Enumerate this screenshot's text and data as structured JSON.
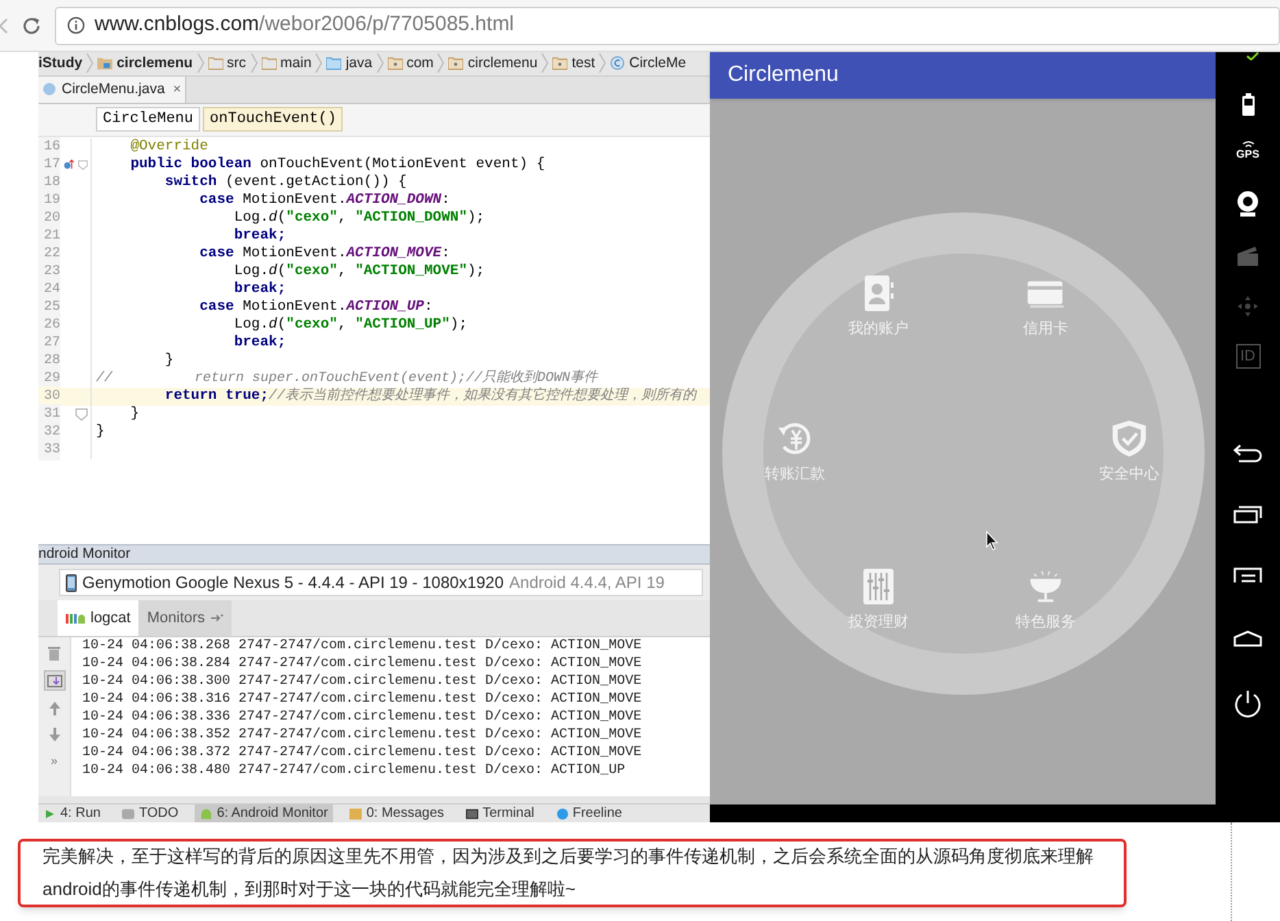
{
  "browser": {
    "url_host": "www.cnblogs.com",
    "url_path": "/webor2006/p/7705085.html"
  },
  "ide": {
    "breadcrumbs": [
      {
        "label": "iStudy",
        "kind": "project"
      },
      {
        "label": "circlemenu",
        "kind": "module"
      },
      {
        "label": "src",
        "kind": "folder"
      },
      {
        "label": "main",
        "kind": "folder"
      },
      {
        "label": "java",
        "kind": "source"
      },
      {
        "label": "com",
        "kind": "package"
      },
      {
        "label": "circlemenu",
        "kind": "package"
      },
      {
        "label": "test",
        "kind": "package"
      },
      {
        "label": "CircleMe",
        "kind": "class"
      }
    ],
    "file_tab": {
      "label": "CircleMenu.java",
      "close": "×"
    },
    "method_breadcrumbs": [
      {
        "label": "CircleMenu",
        "selected": false
      },
      {
        "label": "onTouchEvent()",
        "selected": true
      }
    ],
    "code_lines": [
      {
        "number": "16",
        "current": false,
        "override_marker": false,
        "fold_marker": false,
        "segments": [
          {
            "text": "    @Override",
            "kind": "annotation"
          }
        ]
      },
      {
        "number": "17",
        "current": false,
        "override_marker": true,
        "fold_marker": true,
        "segments": [
          {
            "text": "    public boolean",
            "kind": "keyword"
          },
          {
            "text": " onTouchEvent(MotionEvent event) {",
            "kind": "plain"
          }
        ]
      },
      {
        "number": "18",
        "current": false,
        "override_marker": false,
        "fold_marker": false,
        "segments": [
          {
            "text": "        switch",
            "kind": "keyword"
          },
          {
            "text": " (event.getAction()) {",
            "kind": "plain"
          }
        ]
      },
      {
        "number": "19",
        "current": false,
        "override_marker": false,
        "fold_marker": false,
        "segments": [
          {
            "text": "            case",
            "kind": "keyword"
          },
          {
            "text": " MotionEvent.",
            "kind": "plain"
          },
          {
            "text": "ACTION_DOWN",
            "kind": "constant"
          },
          {
            "text": ":",
            "kind": "plain"
          }
        ]
      },
      {
        "number": "20",
        "current": false,
        "override_marker": false,
        "fold_marker": false,
        "segments": [
          {
            "text": "                Log.",
            "kind": "plain"
          },
          {
            "text": "d",
            "kind": "static"
          },
          {
            "text": "(",
            "kind": "plain"
          },
          {
            "text": "\"cexo\"",
            "kind": "string"
          },
          {
            "text": ", ",
            "kind": "plain"
          },
          {
            "text": "\"ACTION_DOWN\"",
            "kind": "string"
          },
          {
            "text": ");",
            "kind": "plain"
          }
        ]
      },
      {
        "number": "21",
        "current": false,
        "override_marker": false,
        "fold_marker": false,
        "segments": [
          {
            "text": "                break;",
            "kind": "keyword"
          }
        ]
      },
      {
        "number": "22",
        "current": false,
        "override_marker": false,
        "fold_marker": false,
        "segments": [
          {
            "text": "            case",
            "kind": "keyword"
          },
          {
            "text": " MotionEvent.",
            "kind": "plain"
          },
          {
            "text": "ACTION_MOVE",
            "kind": "constant"
          },
          {
            "text": ":",
            "kind": "plain"
          }
        ]
      },
      {
        "number": "23",
        "current": false,
        "override_marker": false,
        "fold_marker": false,
        "segments": [
          {
            "text": "                Log.",
            "kind": "plain"
          },
          {
            "text": "d",
            "kind": "static"
          },
          {
            "text": "(",
            "kind": "plain"
          },
          {
            "text": "\"cexo\"",
            "kind": "string"
          },
          {
            "text": ", ",
            "kind": "plain"
          },
          {
            "text": "\"ACTION_MOVE\"",
            "kind": "string"
          },
          {
            "text": ");",
            "kind": "plain"
          }
        ]
      },
      {
        "number": "24",
        "current": false,
        "override_marker": false,
        "fold_marker": false,
        "segments": [
          {
            "text": "                break;",
            "kind": "keyword"
          }
        ]
      },
      {
        "number": "25",
        "current": false,
        "override_marker": false,
        "fold_marker": false,
        "segments": [
          {
            "text": "            case",
            "kind": "keyword"
          },
          {
            "text": " MotionEvent.",
            "kind": "plain"
          },
          {
            "text": "ACTION_UP",
            "kind": "constant"
          },
          {
            "text": ":",
            "kind": "plain"
          }
        ]
      },
      {
        "number": "26",
        "current": false,
        "override_marker": false,
        "fold_marker": false,
        "segments": [
          {
            "text": "                Log.",
            "kind": "plain"
          },
          {
            "text": "d",
            "kind": "static"
          },
          {
            "text": "(",
            "kind": "plain"
          },
          {
            "text": "\"cexo\"",
            "kind": "string"
          },
          {
            "text": ", ",
            "kind": "plain"
          },
          {
            "text": "\"ACTION_UP\"",
            "kind": "string"
          },
          {
            "text": ");",
            "kind": "plain"
          }
        ]
      },
      {
        "number": "27",
        "current": false,
        "override_marker": false,
        "fold_marker": false,
        "segments": [
          {
            "text": "                break;",
            "kind": "keyword"
          }
        ]
      },
      {
        "number": "28",
        "current": false,
        "override_marker": false,
        "fold_marker": false,
        "segments": [
          {
            "text": "        }",
            "kind": "plain"
          }
        ]
      },
      {
        "number": "29",
        "current": false,
        "override_marker": false,
        "fold_marker": false,
        "segments": [
          {
            "text": "//          return super.onTouchEvent(event);//只能收到DOWN事件",
            "kind": "comment"
          }
        ]
      },
      {
        "number": "30",
        "current": true,
        "override_marker": false,
        "fold_marker": false,
        "segments": [
          {
            "text": "        return true;",
            "kind": "keyword"
          },
          {
            "text": "//表示当前控件想要处理事件，如果没有其它控件想要处理，则所有的",
            "kind": "comment"
          }
        ]
      },
      {
        "number": "31",
        "current": false,
        "override_marker": false,
        "fold_marker": true,
        "segments": [
          {
            "text": "    }",
            "kind": "plain"
          }
        ]
      },
      {
        "number": "32",
        "current": false,
        "override_marker": false,
        "fold_marker": false,
        "segments": [
          {
            "text": "}",
            "kind": "plain"
          }
        ]
      },
      {
        "number": "33",
        "current": false,
        "override_marker": false,
        "fold_marker": false
      }
    ],
    "monitor": {
      "title": "ndroid Monitor",
      "device": {
        "name": "Genymotion Google Nexus 5 - 4.4.4 - API 19 - 1080x1920",
        "detail": "Android 4.4.4, API 19"
      },
      "tabs": [
        {
          "label": "logcat",
          "selected": true
        },
        {
          "label": "Monitors",
          "selected": false
        }
      ],
      "more": "»",
      "log_lines": [
        "10-24 04:06:38.268 2747-2747/com.circlemenu.test D/cexo: ACTION_MOVE",
        "10-24 04:06:38.284 2747-2747/com.circlemenu.test D/cexo: ACTION_MOVE",
        "10-24 04:06:38.300 2747-2747/com.circlemenu.test D/cexo: ACTION_MOVE",
        "10-24 04:06:38.316 2747-2747/com.circlemenu.test D/cexo: ACTION_MOVE",
        "10-24 04:06:38.336 2747-2747/com.circlemenu.test D/cexo: ACTION_MOVE",
        "10-24 04:06:38.352 2747-2747/com.circlemenu.test D/cexo: ACTION_MOVE",
        "10-24 04:06:38.372 2747-2747/com.circlemenu.test D/cexo: ACTION_MOVE",
        "10-24 04:06:38.480 2747-2747/com.circlemenu.test D/cexo: ACTION_UP"
      ]
    },
    "tool_windows": [
      {
        "label": "4: Run",
        "kind": "run",
        "selected": false
      },
      {
        "label": "TODO",
        "kind": "todo",
        "selected": false
      },
      {
        "label": "6: Android Monitor",
        "kind": "android",
        "selected": true
      },
      {
        "label": "0: Messages",
        "kind": "messages",
        "selected": false
      },
      {
        "label": "Terminal",
        "kind": "terminal",
        "selected": false
      },
      {
        "label": "Freeline",
        "kind": "freeline",
        "selected": false
      }
    ]
  },
  "emulator": {
    "app_title": "Circlemenu",
    "menu_items": [
      {
        "label": "我的账户",
        "kind": "account"
      },
      {
        "label": "信用卡",
        "kind": "card"
      },
      {
        "label": "转账汇款",
        "kind": "transfer"
      },
      {
        "label": "安全中心",
        "kind": "security"
      },
      {
        "label": "投资理财",
        "kind": "invest"
      },
      {
        "label": "特色服务",
        "kind": "service"
      }
    ],
    "gps_label": "GPS",
    "id_label": "ID"
  },
  "article": {
    "paragraph": "完美解决，至于这样写的背后的原因这里先不用管，因为涉及到之后要学习的事件传递机制，之后会系统全面的从源码角度彻底来理解android的事件传递机制，到那时对于这一块的代码就能完全理解啦~"
  }
}
